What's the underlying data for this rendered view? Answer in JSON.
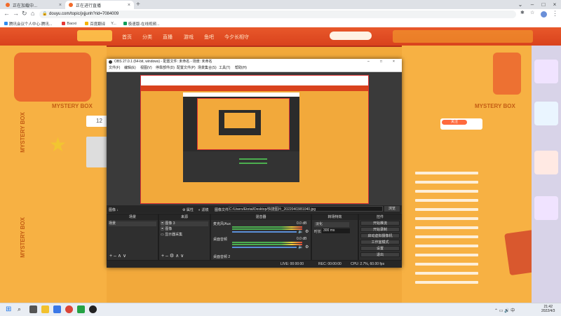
{
  "browser": {
    "tabs": [
      {
        "label": "正在加载中...",
        "active": false
      },
      {
        "label": "正在进行直播",
        "active": true
      }
    ],
    "url": "douyu.com/topic/jxjjunh?rid=7084009",
    "bookmarks": [
      "腾讯会议个人中心-腾讯...",
      "Baoxi",
      "百度翻译",
      "Y...",
      "极速版-在线视频...",
      "..."
    ]
  },
  "site": {
    "nav": [
      "首页",
      "分类",
      "直播",
      "游戏",
      "鱼吧",
      "今夕长相守"
    ],
    "mystery": "MYSTERY BOX",
    "counter": "12",
    "follow_btn": "关注"
  },
  "obs": {
    "title": "OBS 27.0.1 (64-bit, windows) - 配置文件: 未命名 - 场景: 未命名",
    "menu": [
      "文件(F)",
      "编辑(E)",
      "视图(V)",
      "停靠部件(D)",
      "配置文件(P)",
      "场景集合(S)",
      "工具(T)",
      "帮助(H)"
    ],
    "source_toolbar": {
      "label": "图像 ↓",
      "props": "属性",
      "filters": "滤镜",
      "file_label": "图像文件",
      "path": "C:/Users/Etotal/Desktop/快捷图片_20220403/81040.jpg",
      "browse": "浏览"
    },
    "docks": {
      "scenes": {
        "title": "场景",
        "items": [
          "场景"
        ]
      },
      "sources": {
        "title": "来源",
        "items": [
          "图像 3",
          "图像",
          "显示器采集"
        ]
      },
      "mixer": {
        "title": "混音器",
        "channels": [
          {
            "name": "桌面音频",
            "db": "0.0 dB"
          },
          {
            "name": "麦克风/Aux",
            "db": "0.0 dB"
          }
        ],
        "extra": "桌面音频 2"
      },
      "transitions": {
        "title": "转场特效",
        "type": "淡化",
        "duration_label": "时长",
        "duration": "300 ms"
      },
      "controls": {
        "title": "控件",
        "buttons": [
          "开始推流",
          "开始录制",
          "启动虚拟摄像机",
          "工作室模式",
          "设置",
          "退出"
        ]
      }
    },
    "status": {
      "live": "LIVE: 00:00:00",
      "rec": "REC: 00:00:00",
      "cpu": "CPU: 2.7%, 60.00 fps"
    }
  },
  "taskbar": {
    "time": "21:42",
    "date": "2022/4/3"
  }
}
